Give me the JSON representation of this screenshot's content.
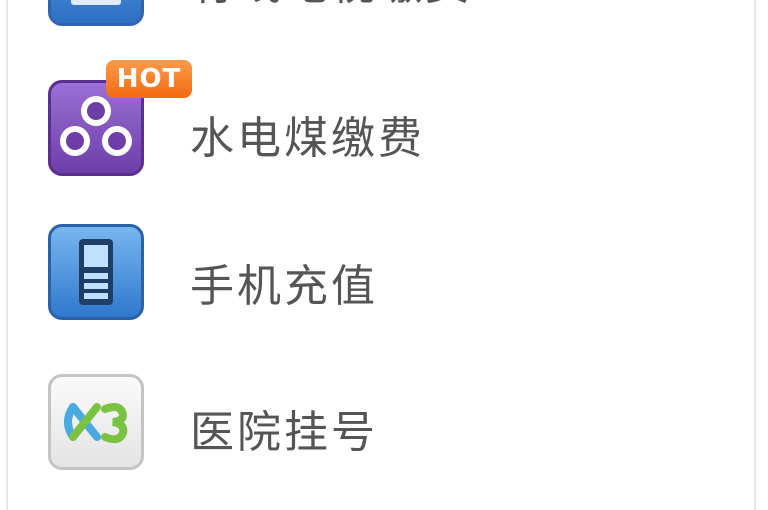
{
  "menu": {
    "items": [
      {
        "label": "有线电视缴费",
        "icon": "tv-icon"
      },
      {
        "label": "水电煤缴费",
        "icon": "utility-icon",
        "badge": "HOT"
      },
      {
        "label": "手机充值",
        "icon": "mobile-phone-icon"
      },
      {
        "label": "医院挂号",
        "icon": "hospital-icon"
      }
    ]
  }
}
